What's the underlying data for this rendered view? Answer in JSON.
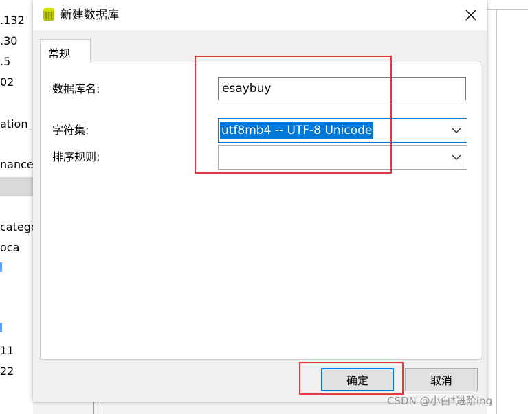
{
  "background": {
    "tree_items": [
      ".132",
      ".30",
      ".5",
      "02",
      "ation_s",
      "nance",
      "catego",
      "oca",
      "11",
      "22"
    ]
  },
  "dialog": {
    "title": "新建数据库",
    "tab": "常规",
    "fields": {
      "db_name_label": "数据库名:",
      "db_name_value": "esaybuy",
      "charset_label": "字符集:",
      "charset_value": "utf8mb4 -- UTF-8 Unicode",
      "collation_label": "排序规则:",
      "collation_value": ""
    },
    "buttons": {
      "ok": "确定",
      "cancel": "取消"
    }
  },
  "watermark": "CSDN @小白*进阶ing",
  "colors": {
    "accent": "#0078d7",
    "annotation_red": "#e33b3b",
    "dialog_bg": "#f0f0f0"
  }
}
